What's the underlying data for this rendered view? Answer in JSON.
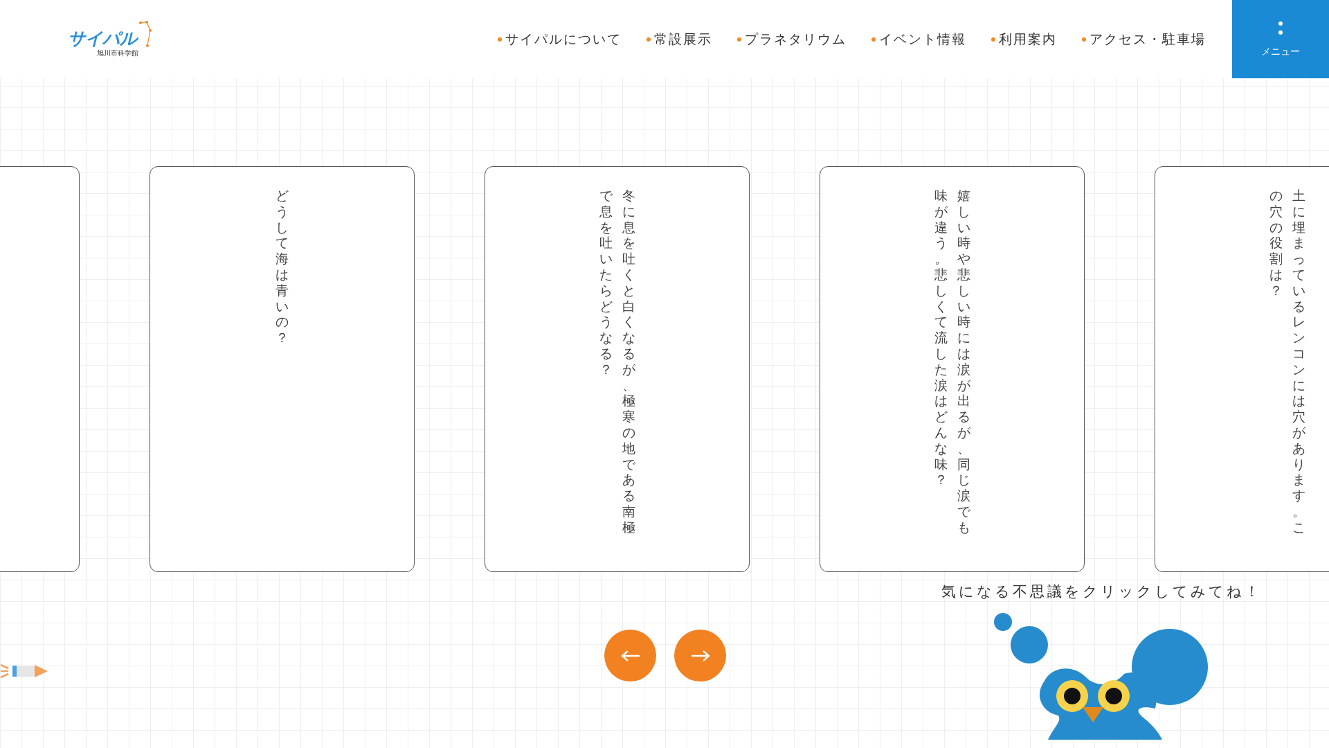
{
  "header": {
    "logo": {
      "name": "サイパル",
      "subtitle": "旭川市科学館"
    },
    "nav": [
      {
        "label": "サイパルについて"
      },
      {
        "label": "常設展示"
      },
      {
        "label": "プラネタリウム"
      },
      {
        "label": "イベント情報"
      },
      {
        "label": "利用案内"
      },
      {
        "label": "アクセス・駐車場"
      }
    ],
    "menu_button": {
      "label": "メニュー"
    }
  },
  "cards": [
    {
      "text": "どうして海は青いの？"
    },
    {
      "text": "冬に息を吐くと白くなるが、極寒の地である南極で息を吐いたらどうなる？"
    },
    {
      "text": "嬉しい時や悲しい時には涙が出るが、同じ涙でも味が違う。悲しくて流した涙はどんな味？"
    },
    {
      "text": "土に埋まっているレンコンには穴があります。この穴の役割は？"
    }
  ],
  "caption": "気になる不思議をクリックしてみてね！"
}
